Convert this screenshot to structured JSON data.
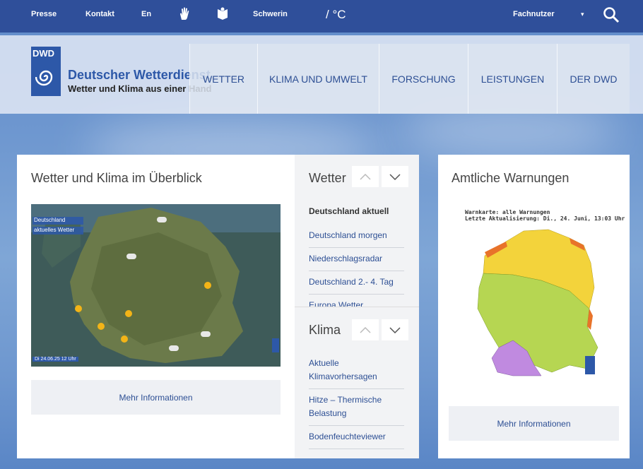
{
  "topbar": {
    "presse": "Presse",
    "kontakt": "Kontakt",
    "lang": "En",
    "city": "Schwerin",
    "unit": "/ °C",
    "user_type": "Fachnutzer",
    "user_dropdown": "▾",
    "search": "⌕"
  },
  "logo": {
    "short": "DWD",
    "title": "Deutscher Wetterdienst",
    "subtitle": "Wetter und Klima aus einer Hand"
  },
  "nav": [
    "WETTER",
    "KLIMA UND UMWELT",
    "FORSCHUNG",
    "LEISTUNGEN",
    "DER DWD"
  ],
  "overview": {
    "title": "Wetter und Klima im Überblick",
    "map_labels": {
      "region": "Deutschland",
      "kind": "aktuelles Wetter",
      "stamp": "Di 24.06.25 12 Uhr"
    },
    "more": "Mehr Informationen"
  },
  "wetter": {
    "title": "Wetter",
    "items": [
      "Deutschland aktuell",
      "Deutschland morgen",
      "Niederschlagsradar",
      "Deutschland 2.- 4. Tag",
      "Europa Wetter"
    ]
  },
  "klima": {
    "title": "Klima",
    "items": [
      "Aktuelle Klimavorhersagen",
      "Hitze – Thermische Belastung",
      "Bodenfeuchteviewer"
    ]
  },
  "warnings": {
    "title": "Amtliche Warnungen",
    "map_title": "Warnkarte: alle Warnungen",
    "map_update": "Letzte Aktualisierung: Di., 24. Juni, 13:03 Uhr",
    "more": "Mehr Informationen"
  },
  "colors": {
    "brand": "#2d58a8",
    "topbar": "#2f4f9a",
    "link": "#2d4f94",
    "warn_yellow": "#f3d33b",
    "warn_green": "#b6d652",
    "warn_purple": "#c08ae0",
    "warn_orange": "#e8732a"
  }
}
